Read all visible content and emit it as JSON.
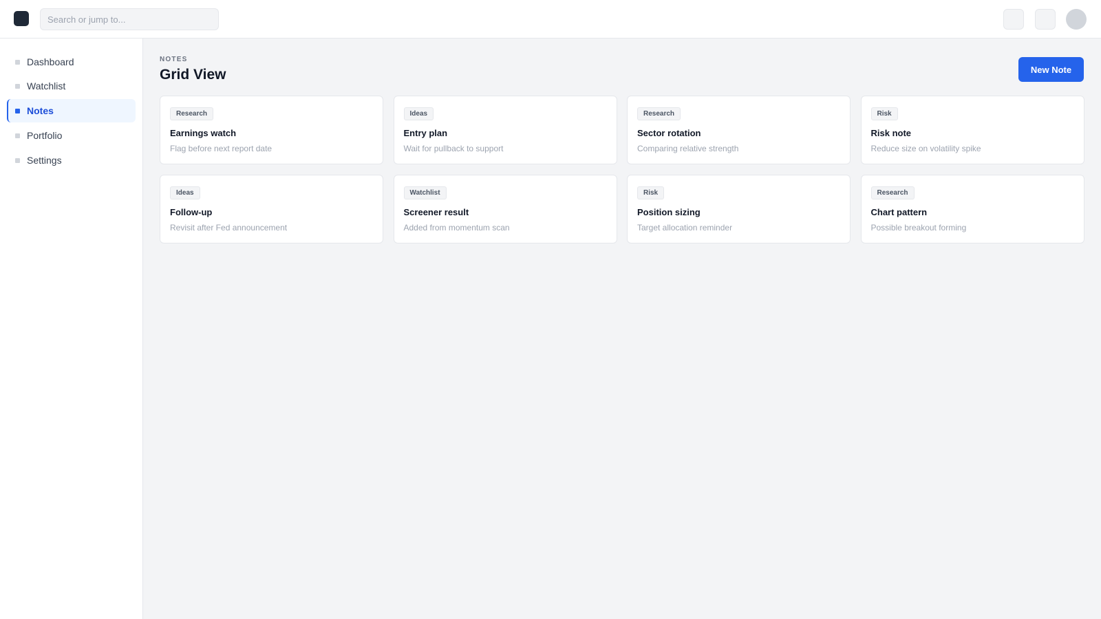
{
  "search": {
    "placeholder": "Search or jump to..."
  },
  "sidebar": {
    "items": [
      {
        "label": "Dashboard"
      },
      {
        "label": "Watchlist"
      },
      {
        "label": "Notes"
      },
      {
        "label": "Portfolio"
      },
      {
        "label": "Settings"
      }
    ]
  },
  "header": {
    "eyebrow": "NOTES",
    "title": "Grid View",
    "new_note_label": "New Note"
  },
  "notes": [
    {
      "tag": "Research",
      "title": "Earnings watch",
      "desc": "Flag before next report date"
    },
    {
      "tag": "Ideas",
      "title": "Entry plan",
      "desc": "Wait for pullback to support"
    },
    {
      "tag": "Research",
      "title": "Sector rotation",
      "desc": "Comparing relative strength"
    },
    {
      "tag": "Risk",
      "title": "Risk note",
      "desc": "Reduce size on volatility spike"
    },
    {
      "tag": "Ideas",
      "title": "Follow-up",
      "desc": "Revisit after Fed announcement"
    },
    {
      "tag": "Watchlist",
      "title": "Screener result",
      "desc": "Added from momentum scan"
    },
    {
      "tag": "Risk",
      "title": "Position sizing",
      "desc": "Target allocation reminder"
    },
    {
      "tag": "Research",
      "title": "Chart pattern",
      "desc": "Possible breakout forming"
    }
  ],
  "colors": {
    "accent": "#2563eb",
    "background": "#f3f4f6",
    "card": "#ffffff"
  }
}
